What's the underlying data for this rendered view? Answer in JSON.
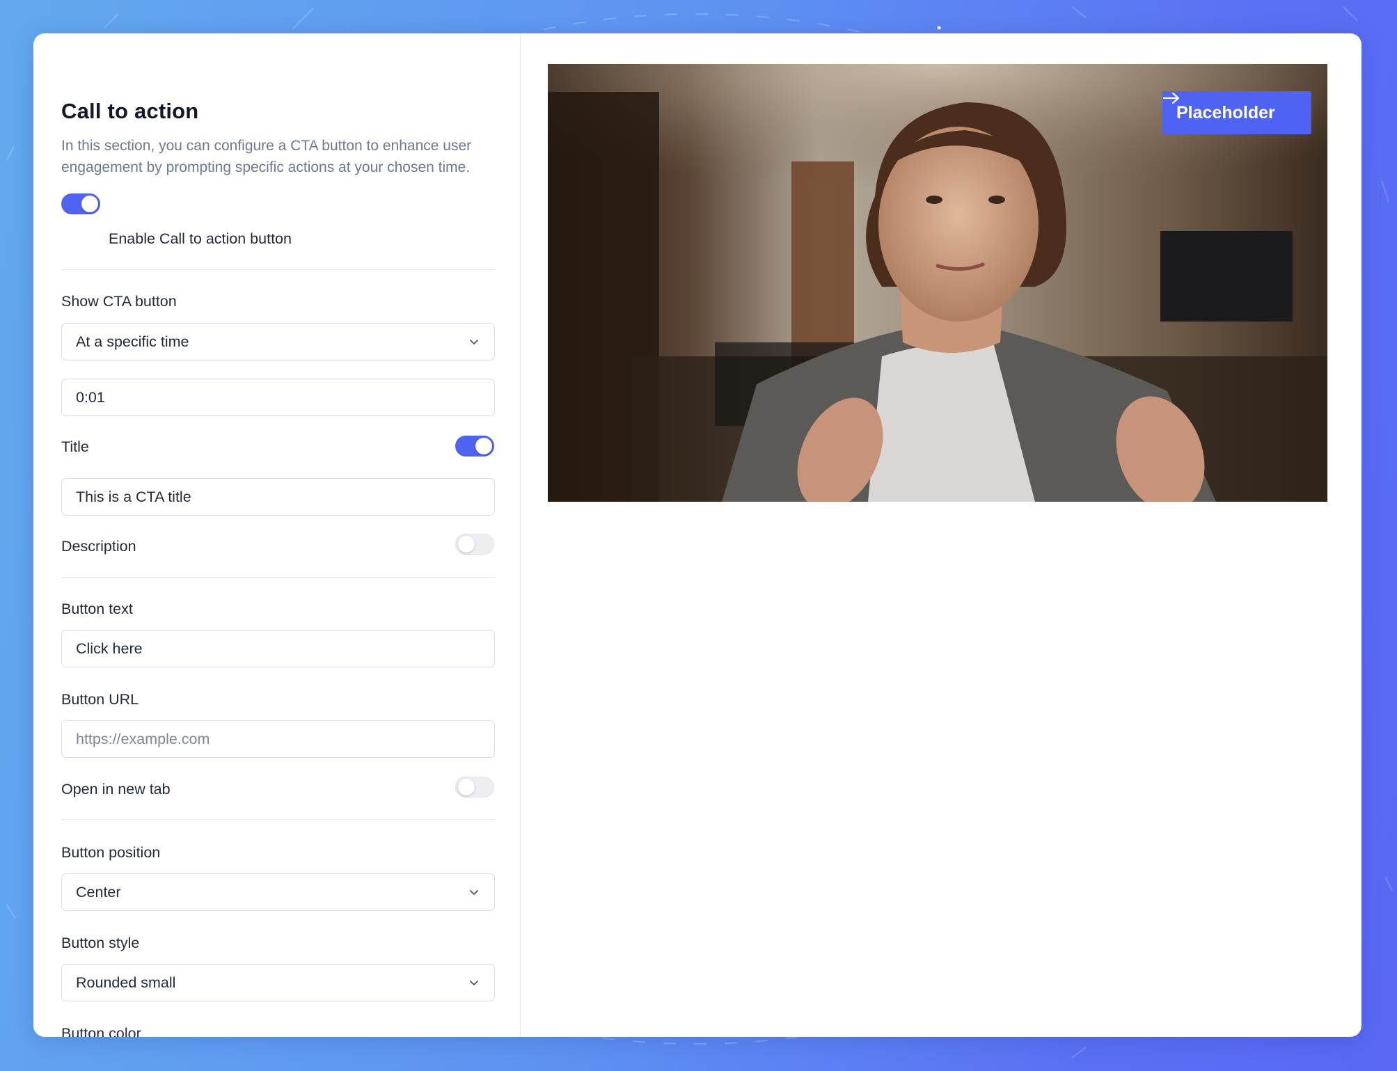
{
  "section": {
    "title": "Call to action",
    "description": "In this section, you can configure a CTA button to enhance user engagement by prompting specific actions at your chosen time."
  },
  "enable_toggle": {
    "label": "Enable Call to action button",
    "on": true
  },
  "show_cta": {
    "label": "Show CTA button",
    "value": "At a specific time"
  },
  "time": {
    "value": "0:01"
  },
  "title_field": {
    "label": "Title",
    "on": true,
    "value": "This is a CTA title"
  },
  "description_field": {
    "label": "Description",
    "on": false
  },
  "button_text": {
    "label": "Button text",
    "value": "Click here"
  },
  "button_url": {
    "label": "Button URL",
    "placeholder": "https://example.com"
  },
  "open_new_tab": {
    "label": "Open in new tab",
    "on": false
  },
  "button_position": {
    "label": "Button position",
    "value": "Center"
  },
  "button_style": {
    "label": "Button style",
    "value": "Rounded small"
  },
  "button_color": {
    "label": "Button color"
  },
  "preview": {
    "cta_label": "Placeholder",
    "accent_color": "#4f63f2",
    "arrow_icon": "arrow-right-icon",
    "video_alt": "man talking to camera in a room"
  },
  "colors": {
    "accent": "#4f63f0",
    "toggle_off": "#eceef1"
  }
}
